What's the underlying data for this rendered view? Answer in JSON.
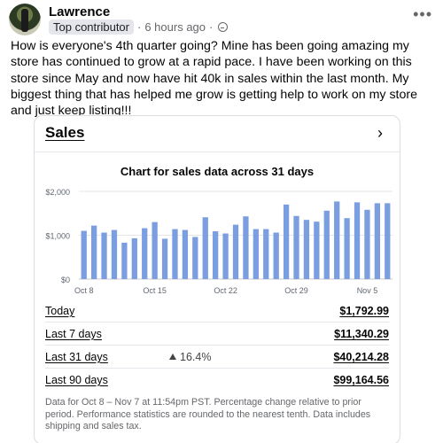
{
  "post": {
    "author": "Lawrence",
    "badge": "Top contributor",
    "time": "6 hours ago",
    "separator": "·",
    "more_icon": "more-icon",
    "text": "How is everyone's 4th quarter going? Mine has been going amazing my store has continued to grow at a rapid pace. I have been working on this store since May and now have hit 40k in sales within the last month. My biggest thing that has helped me grow is getting help to work on my store and just keep listing!!!"
  },
  "card": {
    "title": "Sales",
    "chevron": "›",
    "chart_title": "Chart for sales data across 31 days"
  },
  "chart_data": {
    "type": "bar",
    "title": "Chart for sales data across 31 days",
    "xlabel": "",
    "ylabel": "",
    "y_ticks": [
      "$2,000",
      "$1,000",
      "$0"
    ],
    "y_tick_values": [
      2000,
      1000,
      0
    ],
    "x_tick_labels": [
      "Oct 8",
      "Oct 15",
      "Oct 22",
      "Oct 29",
      "Nov 5"
    ],
    "x_tick_index": [
      0,
      7,
      14,
      21,
      28
    ],
    "ylim": [
      0,
      2000
    ],
    "grid": true,
    "bar_color": "#7b9ee0",
    "categories": [
      "Oct 8",
      "Oct 9",
      "Oct 10",
      "Oct 11",
      "Oct 12",
      "Oct 13",
      "Oct 14",
      "Oct 15",
      "Oct 16",
      "Oct 17",
      "Oct 18",
      "Oct 19",
      "Oct 20",
      "Oct 21",
      "Oct 22",
      "Oct 23",
      "Oct 24",
      "Oct 25",
      "Oct 26",
      "Oct 27",
      "Oct 28",
      "Oct 29",
      "Oct 30",
      "Oct 31",
      "Nov 1",
      "Nov 2",
      "Nov 3",
      "Nov 4",
      "Nov 5",
      "Nov 6",
      "Nov 7"
    ],
    "values": [
      1100,
      1220,
      1060,
      1120,
      830,
      930,
      1160,
      1300,
      920,
      1140,
      1120,
      960,
      1410,
      1090,
      1040,
      1240,
      1430,
      1140,
      1140,
      1060,
      1700,
      1440,
      1350,
      1310,
      1560,
      1770,
      1390,
      1750,
      1580,
      1730,
      1730
    ]
  },
  "rows": [
    {
      "label": "Today",
      "value": "$1,792.99",
      "change": ""
    },
    {
      "label": "Last 7 days",
      "value": "$11,340.29",
      "change": ""
    },
    {
      "label": "Last 31 days",
      "value": "$40,214.28",
      "change": "16.4%"
    },
    {
      "label": "Last 90 days",
      "value": "$99,164.56",
      "change": ""
    }
  ],
  "footnote": "Data for Oct 8 – Nov 7 at 11:54pm PST. Percentage change relative to prior period. Performance statistics are rounded to the nearest tenth. Data includes shipping and sales tax."
}
